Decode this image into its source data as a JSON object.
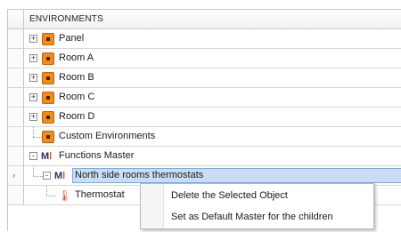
{
  "tree": {
    "header": "ENVIRONMENTS",
    "items": [
      {
        "label": "Panel",
        "expander": "+"
      },
      {
        "label": "Room A",
        "expander": "+"
      },
      {
        "label": "Room B",
        "expander": "+"
      },
      {
        "label": "Room C",
        "expander": "+"
      },
      {
        "label": "Room D",
        "expander": "+"
      },
      {
        "label": "Custom Environments"
      },
      {
        "label": "Functions Master",
        "expander": "-"
      },
      {
        "label": "North side rooms thermostats",
        "expander": "-"
      },
      {
        "label": "Thermostat"
      }
    ],
    "current_row_marker": "›"
  },
  "context_menu": {
    "items": [
      {
        "label": "Delete the Selected Object"
      },
      {
        "label": "Set as Default Master for the children"
      }
    ]
  },
  "colors": {
    "selection": "#c9def5",
    "selection_border": "#7fa8dc",
    "environment_icon": "#f28c16",
    "thermostat_icon": "#d0532a"
  },
  "icons": {
    "expand": "plus-box-icon",
    "collapse": "minus-box-icon",
    "environment": "environment-node-icon",
    "master": "functions-master-icon",
    "thermostat": "thermometer-icon"
  }
}
